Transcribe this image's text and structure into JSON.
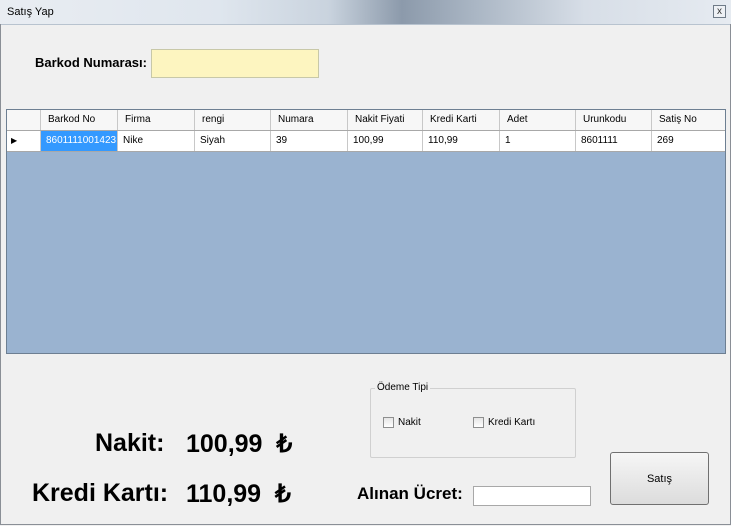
{
  "window": {
    "title": "Satış Yap",
    "close_symbol": "x"
  },
  "barcode": {
    "label": "Barkod Numarası:",
    "value": ""
  },
  "grid": {
    "columns": [
      "Barkod No",
      "Firma",
      "rengi",
      "Numara",
      "Nakit Fiyati",
      "Kredi Karti",
      "Adet",
      "Urunkodu",
      "Satiş No"
    ],
    "rows": [
      [
        "8601111001423",
        "Nike",
        "Siyah",
        "39",
        "100,99",
        "110,99",
        "1",
        "8601111",
        "269"
      ]
    ],
    "row_indicator": "▶"
  },
  "payment": {
    "group_title": "Ödeme Tipi",
    "nakit_label": "Nakit",
    "kredi_label": "Kredi Kartı"
  },
  "totals": {
    "nakit_label": "Nakit:",
    "nakit_value": "100,99  ₺",
    "kredi_label": "Kredi Kartı:",
    "kredi_value": "110,99  ₺"
  },
  "alinan": {
    "label": "Alınan Ücret:",
    "value": ""
  },
  "actions": {
    "satis_label": "Satış"
  }
}
